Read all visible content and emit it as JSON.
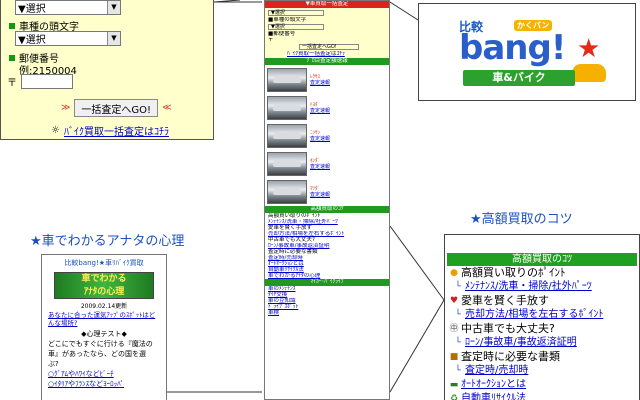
{
  "form_panel": {
    "select1": "▼選択",
    "initial_label": "車種の頭文字",
    "select2": "▼選択",
    "zip_label": "郵便番号",
    "zip_example": "例:2150004",
    "zip_prefix": "〒",
    "zip_value": "",
    "submit": "一括査定へGO!",
    "submit_prefix": "≫",
    "submit_suffix": "≪",
    "bike_link": "ﾊﾞｲｸ買取一括査定はｺﾁﾗ"
  },
  "phone_page": {
    "top_bar": "▼車買取一括査定",
    "select_lines": [
      "▼選択",
      "■車種の頭文字",
      "▼選択",
      "■郵便番号",
      "〒"
    ],
    "submit": "一括査定へGO!",
    "bike_link": "ﾊﾞｲｸ買取一括査定はｺﾁﾗ",
    "ranking_bar": "ｿﾞﾛ目査定額速報",
    "cars": [
      {
        "label": "ﾚｸｻｽ",
        "link": "査定速報"
      },
      {
        "label": "ﾄﾖﾀ",
        "link": "査定速報"
      },
      {
        "label": "ﾆｯｻﾝ",
        "link": "査定速報"
      },
      {
        "label": "ﾎﾝﾀﾞ",
        "link": "査定速報"
      },
      {
        "label": "ﾏﾂﾀﾞ",
        "link": "査定速報"
      }
    ],
    "tips_bar": "高額買取のｺﾂ",
    "tips_lines": [
      "高額買い取りのﾎﾟｲﾝﾄ",
      "ﾒﾝﾃﾅﾝｽ/洗車・掃除/社外ﾊﾟｰﾂ",
      "愛車を賢く手放す",
      "売却方法/相場を左右するﾎﾟｲﾝﾄ",
      "中古車でも大丈夫?",
      "ﾛｰﾝ/事故車/事故返済証明",
      "査定時に必要な書類",
      "査定時/売却時",
      "ｵｰﾄｵｰｸｼｮﾝとは",
      "自動車ﾘｻｲｸﾙ法",
      "車でわかるｱﾅﾀの心理"
    ],
    "bottom_bar": "ﾏｲｶｰ･ﾊﾞｲｸﾗｲﾌ",
    "bottom_lines": [
      "車のﾒﾝﾃﾅﾝｽ",
      "ﾀｲﾔ交換",
      "車の豆知識",
      "ﾄﾞﾗｲﾌﾞｽﾎﾟｯﾄ",
      "車検"
    ]
  },
  "logo": {
    "top": "比較",
    "wide": "かくバン",
    "main": "bang!",
    "star": "★",
    "bar": "車&バイク"
  },
  "headings": {
    "tips": "★高額買取のコツ",
    "psychology": "★車でわかるアナタの心理"
  },
  "psy_page": {
    "header": "比較bang!★車ﾘﾊﾞｲｸ買取",
    "banner_line1": "車でわかる",
    "banner_line2": "ｱﾅﾀの心理",
    "date": "2009.02.14更新",
    "question_link": "あなたに合った運気ｱｯﾌﾟのｽﾎﾟｯﾄはどんな場所?",
    "test_title": "◆心理テスト◆",
    "body1": "どこにでもすぐに行ける『魔法の",
    "body2": "車』があったなら、どの国を選",
    "body3": "ぶ?",
    "options": [
      "○ｸﾞｱﾑやﾊﾜｲなどﾋﾞｰﾁ",
      "○ｲﾀﾘｱやﾌﾗﾝｽなどﾖｰﾛｯﾊﾟ"
    ]
  },
  "tips_panel": {
    "bar": "高額買取のｺﾂ",
    "lines": [
      {
        "text": "高額買い取りのﾎﾟｲﾝﾄ",
        "link": false
      },
      {
        "text": "ﾒﾝﾃﾅﾝｽ/洗車・掃除/社外ﾊﾟｰﾂ",
        "link": true
      },
      {
        "text": "愛車を賢く手放す",
        "link": false
      },
      {
        "text": "売却方法/相場を左右するﾎﾟｲﾝﾄ",
        "link": true
      },
      {
        "text": "中古車でも大丈夫?",
        "link": false
      },
      {
        "text": "ﾛｰﾝ/事故車/事故返済証明",
        "link": true
      },
      {
        "text": "査定時に必要な書類",
        "link": false
      },
      {
        "text": "査定時/売却時",
        "link": true
      },
      {
        "text": "ｵｰﾄｵｰｸｼｮﾝとは",
        "link": true
      },
      {
        "text": "自動車ﾘｻｲｸﾙ法",
        "link": true
      }
    ]
  },
  "colors": {
    "green_bar": "#20a020",
    "link_blue": "#0000cc",
    "heading_blue": "#1a50c0",
    "panel_yellow": "#ffffcc"
  }
}
